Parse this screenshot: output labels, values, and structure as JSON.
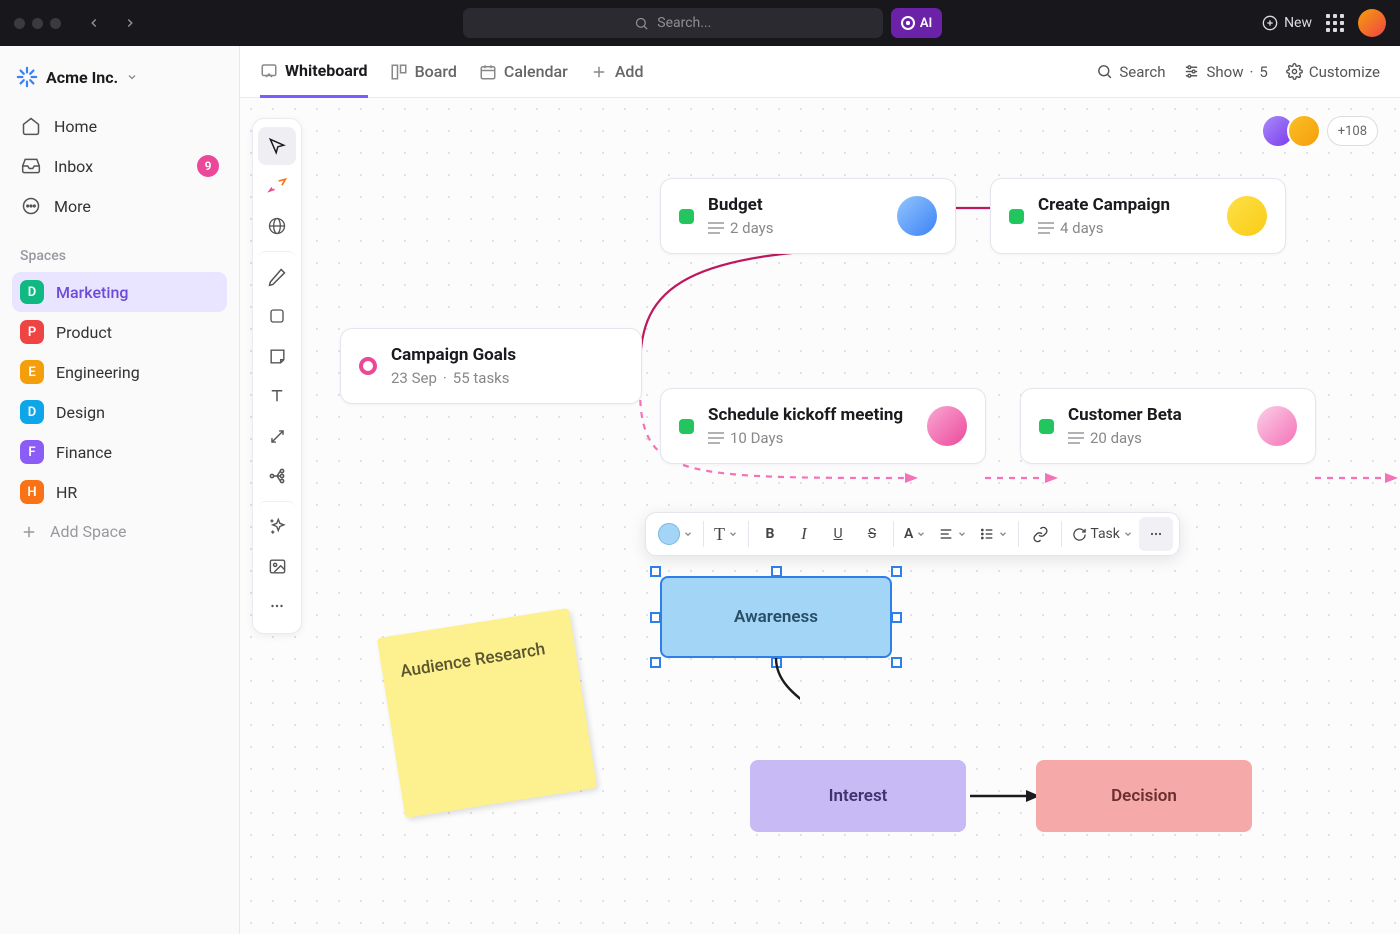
{
  "topbar": {
    "search_placeholder": "Search...",
    "ai_label": "AI",
    "new_label": "New"
  },
  "workspace": {
    "name": "Acme Inc."
  },
  "nav": {
    "home": "Home",
    "inbox": "Inbox",
    "inbox_count": "9",
    "more": "More"
  },
  "spaces_header": "Spaces",
  "spaces": [
    {
      "letter": "D",
      "label": "Marketing",
      "color": "#10b981",
      "active": true
    },
    {
      "letter": "P",
      "label": "Product",
      "color": "#ef4444"
    },
    {
      "letter": "E",
      "label": "Engineering",
      "color": "#f59e0b"
    },
    {
      "letter": "D",
      "label": "Design",
      "color": "#0ea5e9"
    },
    {
      "letter": "F",
      "label": "Finance",
      "color": "#8b5cf6"
    },
    {
      "letter": "H",
      "label": "HR",
      "color": "#f97316"
    }
  ],
  "add_space": "Add Space",
  "tabs": {
    "whiteboard": "Whiteboard",
    "board": "Board",
    "calendar": "Calendar",
    "add": "Add"
  },
  "tabright": {
    "search": "Search",
    "show": "Show",
    "show_count": "5",
    "customize": "Customize"
  },
  "collab_more": "+108",
  "cards": {
    "root": {
      "title": "Campaign Goals",
      "date": "23 Sep",
      "tasks": "55 tasks"
    },
    "budget": {
      "title": "Budget",
      "sub": "2 days"
    },
    "campaign": {
      "title": "Create Campaign",
      "sub": "4 days"
    },
    "kickoff": {
      "title": "Schedule kickoff meeting",
      "sub": "10 Days"
    },
    "beta": {
      "title": "Customer Beta",
      "sub": "20 days"
    }
  },
  "sticky": "Audience Research",
  "flow": {
    "awareness": "Awareness",
    "interest": "Interest",
    "decision": "Decision"
  },
  "floatbar": {
    "task": "Task"
  },
  "avatar_colors": {
    "a1": "linear-gradient(135deg,#a78bfa,#7c3aed)",
    "a2": "linear-gradient(135deg,#fbbf24,#f59e0b)",
    "budget": "linear-gradient(135deg,#93c5fd,#3b82f6)",
    "campaign": "linear-gradient(135deg,#fde047,#facc15)",
    "kickoff": "linear-gradient(135deg,#f9a8d4,#ec4899)",
    "beta": "linear-gradient(135deg,#fbcfe8,#f472b6)"
  }
}
